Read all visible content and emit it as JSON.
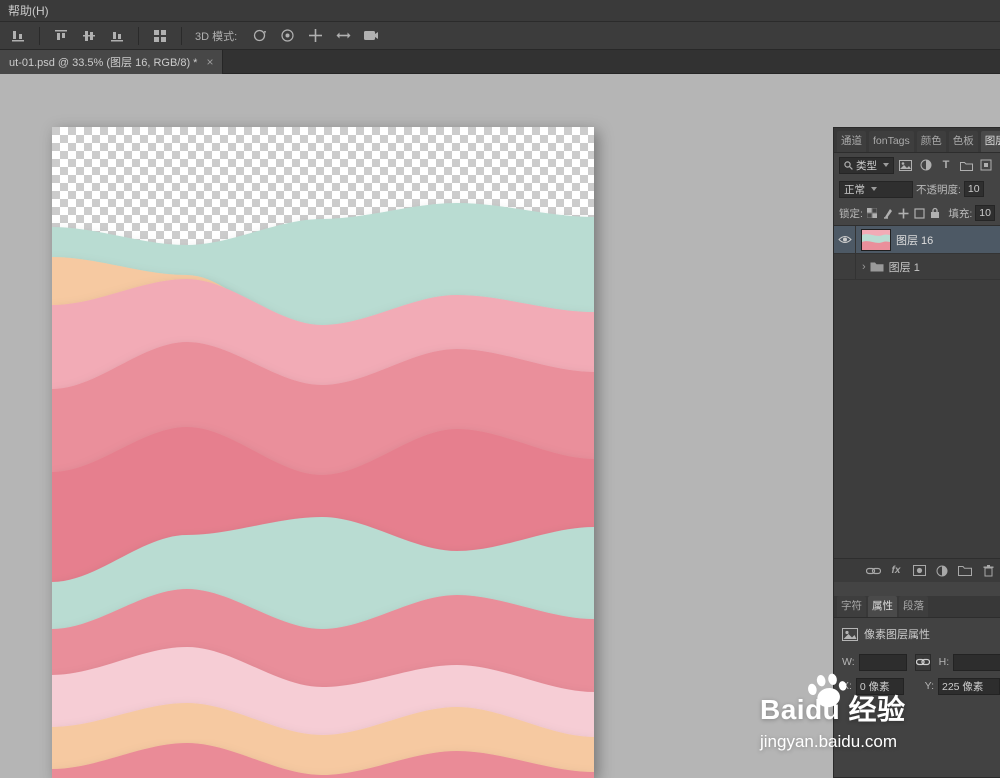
{
  "menu_bar": {
    "help_label": "帮助(H)"
  },
  "options_bar": {
    "mode_label": "3D 模式:"
  },
  "doc_tab": {
    "title": "ut-01.psd @ 33.5% (图层 16, RGB/8) *",
    "close_glyph": "×"
  },
  "layers_panel": {
    "tabs": [
      {
        "label": "通道"
      },
      {
        "label": "fonTags"
      },
      {
        "label": "颜色"
      },
      {
        "label": "色板"
      },
      {
        "label": "图层"
      }
    ],
    "filter_label": "类型",
    "blend_mode": "正常",
    "opacity_label": "不透明度:",
    "opacity_value": "10",
    "lock_label": "锁定:",
    "fill_label": "填充:",
    "fill_value": "10",
    "group_arrow": "›",
    "fx_label": "fx",
    "layers": [
      {
        "name": "图层 16"
      },
      {
        "name": "图层 1"
      }
    ]
  },
  "props_panel": {
    "tabs": [
      {
        "label": "字符"
      },
      {
        "label": "属性"
      },
      {
        "label": "段落"
      }
    ],
    "title": "像素图层属性",
    "w_label": "W:",
    "h_label": "H:",
    "x_label": "X:",
    "x_value": "0 像素",
    "y_label": "Y:",
    "y_value": "225 像素"
  },
  "watermark": {
    "brand": "Baidu 经验",
    "url": "jingyan.baidu.com"
  },
  "artwork": {
    "wave_colors": [
      "#b9dcd2",
      "#f6c9a1",
      "#f2abb6",
      "#ea8f9b",
      "#e67f8e",
      "#b9dcd2",
      "#e98e9a",
      "#f6cdd5",
      "#f6c9a1",
      "#ea8b97"
    ]
  }
}
